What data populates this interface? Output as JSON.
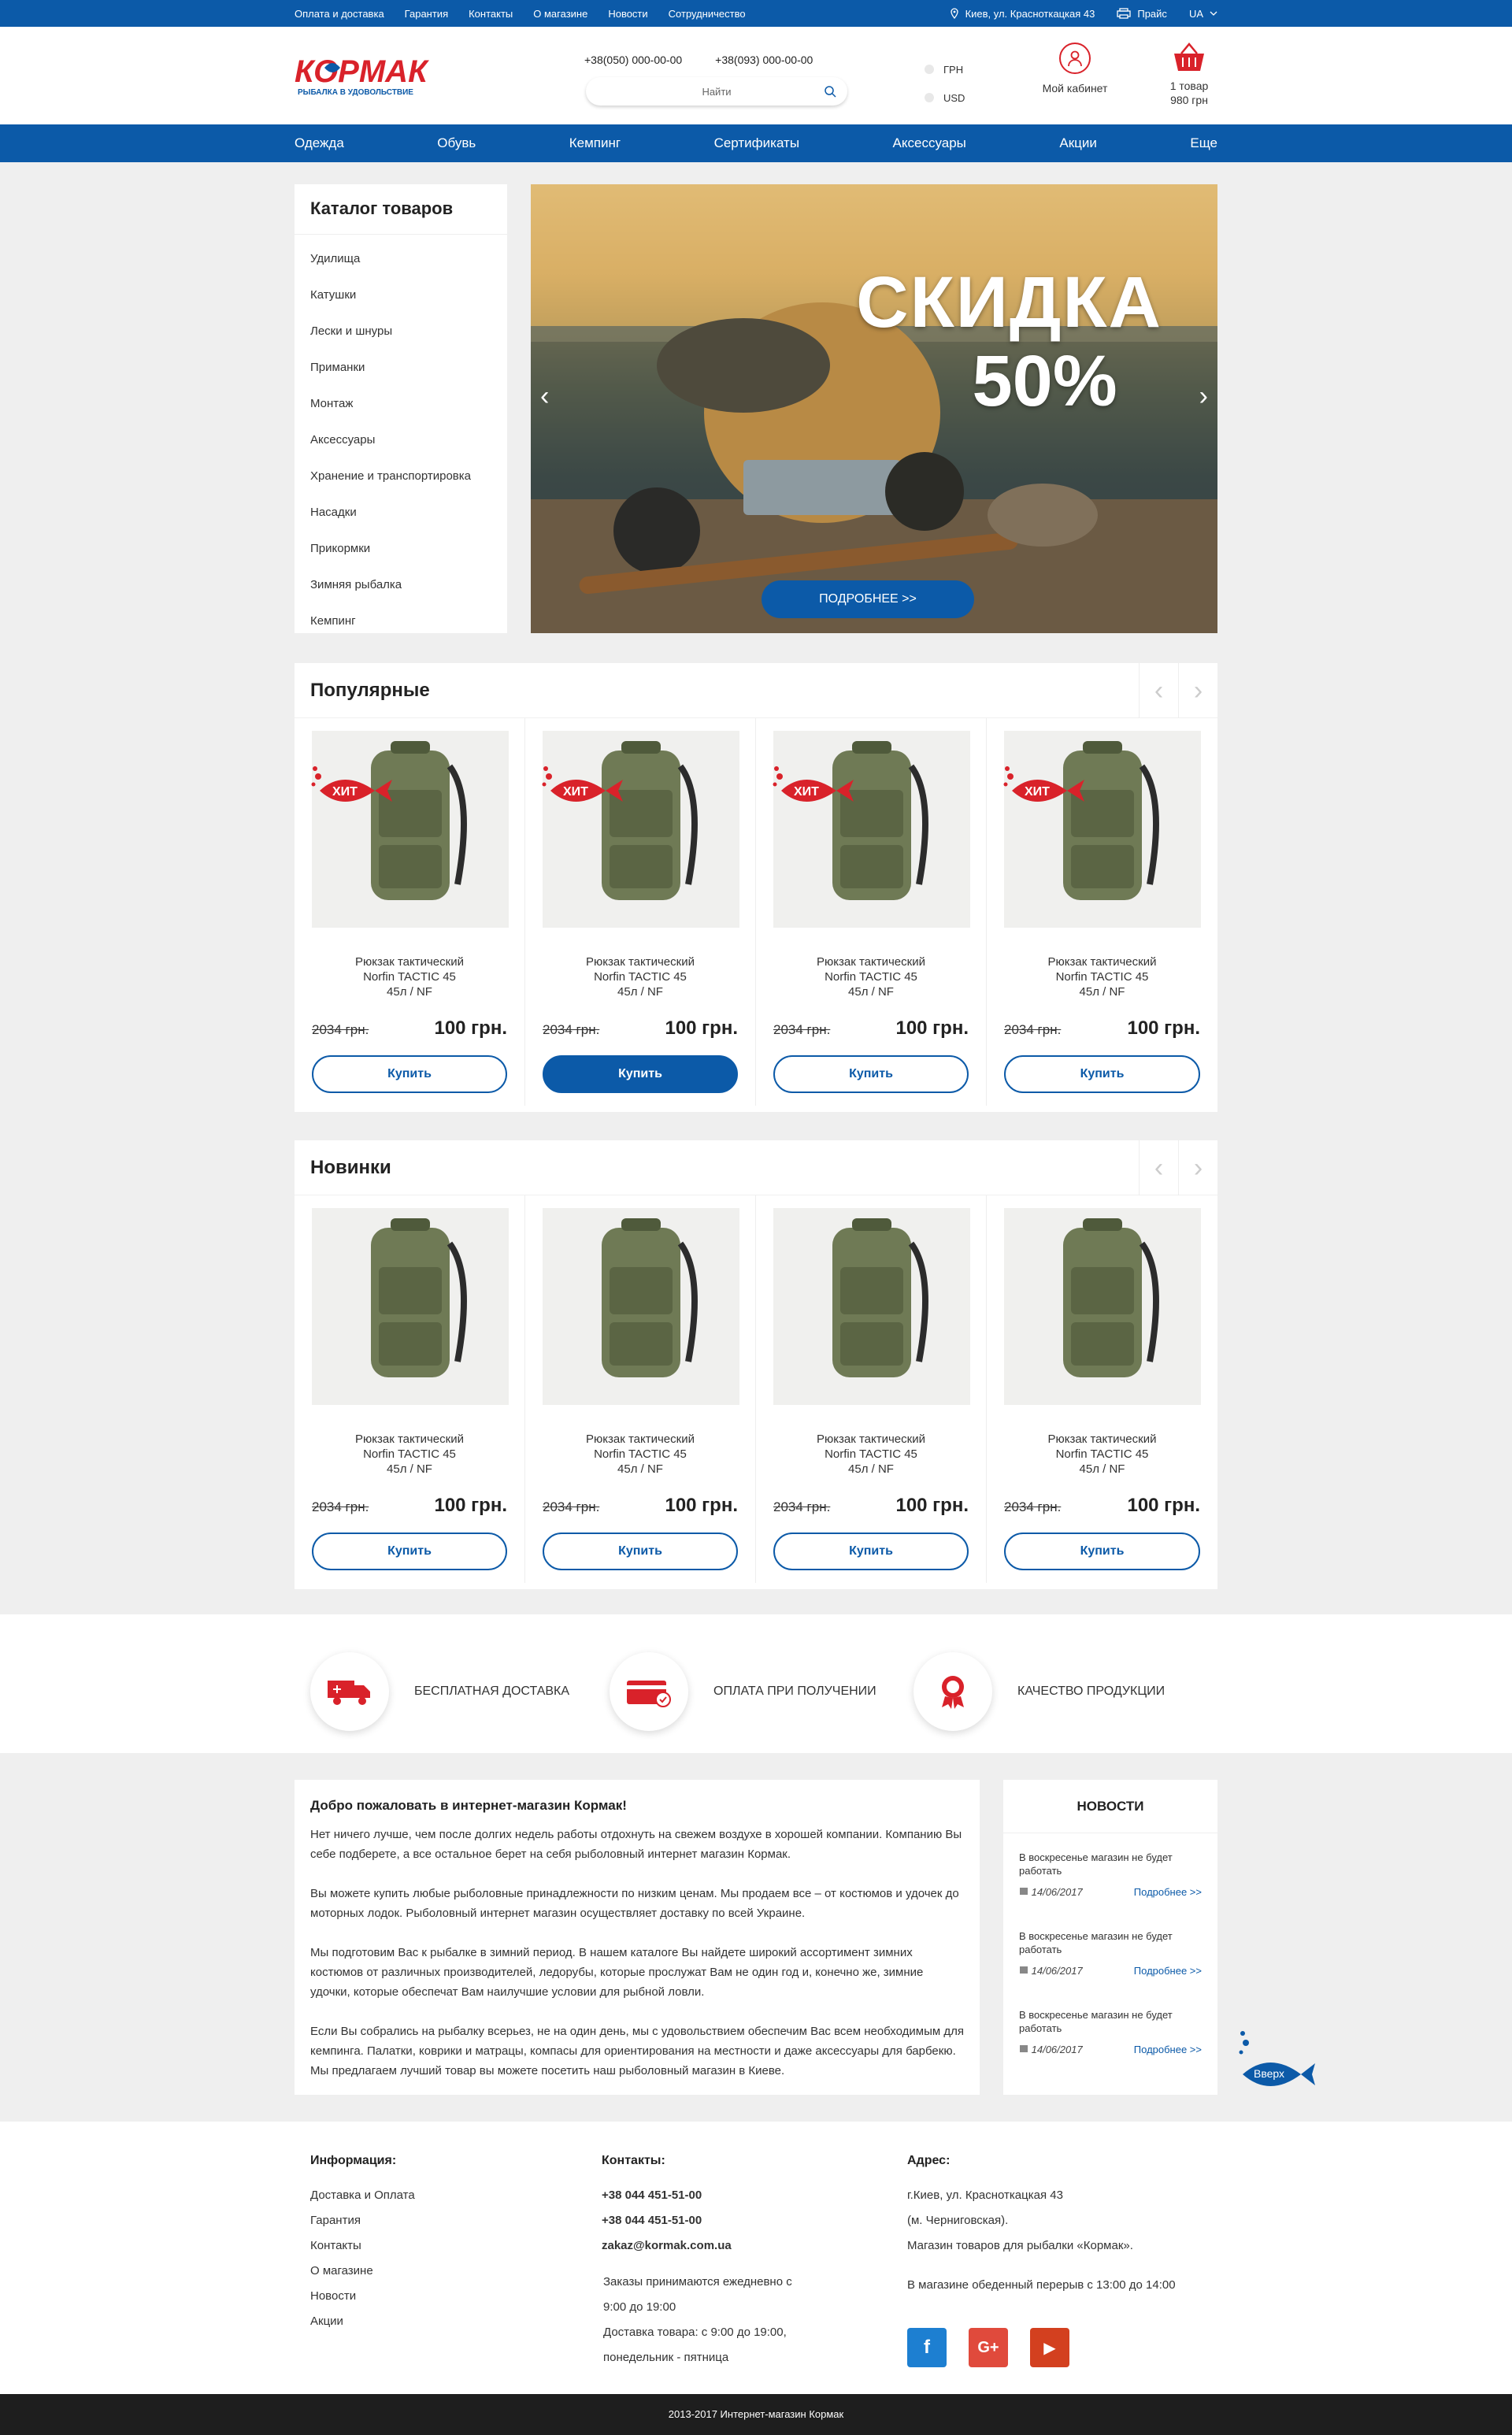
{
  "topbar": {
    "links": [
      "Оплата и доставка",
      "Гарантия",
      "Контакты",
      "О магазине",
      "Новости",
      "Сотрудничество"
    ],
    "address": "Киев, ул. Красноткацкая 43",
    "price": "Прайс",
    "lang": "UA"
  },
  "header": {
    "phone1": "+38(050) 000-00-00",
    "phone2": "+38(093) 000-00-00",
    "search_placeholder": "Найти",
    "currency1": "ГРН",
    "currency2": "USD",
    "cabinet": "Мой кабинет",
    "cart_count": "1 товар",
    "cart_sum": "980 грн",
    "logo_text": "КОРМАК",
    "logo_sub": "РЫБАЛКА В УДОВОЛЬСТВИЕ"
  },
  "nav": [
    "Одежда",
    "Обувь",
    "Кемпинг",
    "Сертификаты",
    "Аксессуары",
    "Акции",
    "Еще"
  ],
  "catalog": {
    "title": "Каталог товаров",
    "items": [
      "Удилища",
      "Катушки",
      "Лески и шнуры",
      "Приманки",
      "Монтаж",
      "Аксессуары",
      "Хранение и транспортировка",
      "Насадки",
      "Прикормки",
      "Зимняя рыбалка",
      "Кемпинг"
    ]
  },
  "banner": {
    "line1": "СКИДКА",
    "line2": "50%",
    "button": "ПОДРОБНЕЕ >>"
  },
  "popular": {
    "title": "Популярные",
    "badge": "ХИТ",
    "products": [
      {
        "name1": "Рюкзак тактический",
        "name2": "Norfin TACTIC 45",
        "name3": "45л / NF",
        "old": "2034 грн.",
        "new": "100 грн.",
        "buy": "Купить"
      },
      {
        "name1": "Рюкзак тактический",
        "name2": "Norfin TACTIC 45",
        "name3": "45л / NF",
        "old": "2034 грн.",
        "new": "100 грн.",
        "buy": "Купить"
      },
      {
        "name1": "Рюкзак тактический",
        "name2": "Norfin TACTIC 45",
        "name3": "45л / NF",
        "old": "2034 грн.",
        "new": "100 грн.",
        "buy": "Купить"
      },
      {
        "name1": "Рюкзак тактический",
        "name2": "Norfin TACTIC 45",
        "name3": "45л / NF",
        "old": "2034 грн.",
        "new": "100 грн.",
        "buy": "Купить"
      }
    ]
  },
  "newitems": {
    "title": "Новинки",
    "products": [
      {
        "name1": "Рюкзак тактический",
        "name2": "Norfin TACTIC 45",
        "name3": "45л / NF",
        "old": "2034 грн.",
        "new": "100 грн.",
        "buy": "Купить"
      },
      {
        "name1": "Рюкзак тактический",
        "name2": "Norfin TACTIC 45",
        "name3": "45л / NF",
        "old": "2034 грн.",
        "new": "100 грн.",
        "buy": "Купить"
      },
      {
        "name1": "Рюкзак тактический",
        "name2": "Norfin TACTIC 45",
        "name3": "45л / NF",
        "old": "2034 грн.",
        "new": "100 грн.",
        "buy": "Купить"
      },
      {
        "name1": "Рюкзак тактический",
        "name2": "Norfin TACTIC 45",
        "name3": "45л / NF",
        "old": "2034 грн.",
        "new": "100 грн.",
        "buy": "Купить"
      }
    ]
  },
  "advantages": [
    "БЕСПЛАТНАЯ ДОСТАВКА",
    "ОПЛАТА ПРИ ПОЛУЧЕНИИ",
    "КАЧЕСТВО ПРОДУКЦИИ"
  ],
  "about": {
    "title": "Добро пожаловать в интернет-магазин Кормак!",
    "p1": "Нет ничего лучше, чем после долгих недель работы отдохнуть на свежем воздухе в хорошей компании. Компанию Вы себе подберете, а все остальное берет на себя рыболовный интернет магазин Кормак.",
    "p2": "Вы можете купить любые рыболовные принадлежности по низким ценам. Мы продаем все – от костюмов и удочек до моторных лодок. Рыболовный интернет магазин осуществляет доставку по всей Украине.",
    "p3": "Мы подготовим Вас к рыбалке в зимний период. В нашем каталоге Вы найдете широкий ассортимент зимних костюмов от различных производителей, ледорубы, которые прослужат Вам не один год и, конечно же, зимние удочки, которые обеспечат Вам наилучшие условии для рыбной ловли.",
    "p4": "Если Вы собрались на рыбалку всерьез, не на один день, мы с удовольствием обеспечим Вас всем необходимым для кемпинга. Палатки, коврики и матрацы, компасы для ориентирования на местности и даже аксессуары для барбекю. Мы предлагаем лучший товар вы можете посетить наш рыболовный магазин в Киеве."
  },
  "news": {
    "title": "НОВОСТИ",
    "items": [
      {
        "text": "В воскресенье магазин не будет работать",
        "date": "14/06/2017",
        "more": "Подробнее >>"
      },
      {
        "text": "В воскресенье магазин не будет работать",
        "date": "14/06/2017",
        "more": "Подробнее >>"
      },
      {
        "text": "В воскресенье магазин не будет работать",
        "date": "14/06/2017",
        "more": "Подробнее >>"
      }
    ]
  },
  "up": "Вверх",
  "footer": {
    "info_title": "Информация:",
    "info": [
      "Доставка и Оплата",
      "Гарантия",
      "Контакты",
      "О магазине",
      "Новости",
      "Акции"
    ],
    "contacts_title": "Контакты:",
    "phone1": "+38 044 451-51-00",
    "phone2": "+38 044 451-51-00",
    "email": "zakaz@kormak.com.ua",
    "orders1": "Заказы принимаются ежедневно с",
    "orders2": "9:00 до 19:00",
    "delivery1": "Доставка товара: с 9:00 до 19:00,",
    "delivery2": "понедельник - пятница",
    "address_title": "Адрес:",
    "addr1": "г.Киев, ул. Красноткацкая 43",
    "addr2": "(м. Черниговская).",
    "addr3": "Магазин товаров для рыбалки «Кормак».",
    "break": "В магазине обеденный перерыв с 13:00 до 14:00",
    "social": [
      "f",
      "G+",
      "▶"
    ],
    "copyright": "2013-2017 Интернет-магазин Кормак"
  },
  "colors": {
    "brand_blue": "#0c5aa8",
    "accent_red": "#d9222a",
    "facebook": "#1d7fd1",
    "google": "#e04a3c",
    "youtube": "#d3401f"
  }
}
